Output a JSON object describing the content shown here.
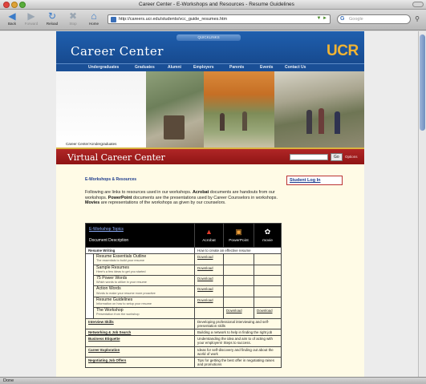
{
  "window": {
    "title": "Career Center - E-Workshops and Resources - Resume Guidelines"
  },
  "toolbar": {
    "back_label": "Back",
    "forward_label": "Forward",
    "reload_label": "Reload",
    "stop_label": "Stop",
    "home_label": "Home",
    "url": "http://careers.ucr.edu/students/vcc_guide_resumes.htm",
    "search_placeholder": "Google"
  },
  "page": {
    "quicklinks": "QUICKLINKS",
    "site_title": "Career Center",
    "logo": "UCR",
    "nav": [
      "Undergraduates",
      "Graduates",
      "Alumni",
      "Employers",
      "Parents",
      "Events",
      "Contact Us"
    ],
    "breadcrumb": "Career Center>Undergraduates",
    "vcc_title": "Virtual Career Center",
    "go_label": "Go",
    "options_label": "Options",
    "section_heading": "E-Workshops & Resources",
    "intro_p1": "Following are links to resources used in our workshops. ",
    "intro_acrobat": "Acrobat",
    "intro_p2": " documents are handouts from our workshops. ",
    "intro_ppt": "PowerPoint",
    "intro_p3": " documents are the presentations used by Career Counselors in workshops. ",
    "intro_movies": "Movies",
    "intro_p4": " are representations of the workshops as given by our counselors.",
    "login_label": "Student Log In",
    "table": {
      "topics_label": "E-Workshop Topics",
      "doc_desc_label": "Document Description",
      "col_acrobat": "Acrobat",
      "col_ppt": "PowerPoint",
      "col_movie": "movie",
      "resume_section": {
        "title": "Resume Writing",
        "desc": "How to create an effective resume"
      },
      "resume_items": [
        {
          "title": "Resume Essentials Outline",
          "desc": "The essentials to build your resume",
          "acrobat": "Download",
          "ppt": "",
          "movie": ""
        },
        {
          "title": "Sample Resumes",
          "desc": "Here's a few ideas to get you started",
          "acrobat": "Download",
          "ppt": "",
          "movie": ""
        },
        {
          "title": "75 Power Words",
          "desc": "Which words to utilize in your resume",
          "acrobat": "Download",
          "ppt": "",
          "movie": ""
        },
        {
          "title": "Action Words",
          "desc": "Words to make your resume more proactive",
          "acrobat": "Download",
          "ppt": "",
          "movie": ""
        },
        {
          "title": "Resume Guidelines",
          "desc": "Information on how to setup your resume",
          "acrobat": "Download",
          "ppt": "",
          "movie": ""
        },
        {
          "title": "The Workshop",
          "desc": "Presentation from the workshop",
          "acrobat": "",
          "ppt": "Download",
          "movie": "Download"
        }
      ],
      "topics": [
        {
          "title": "Interview Skills",
          "desc": "Developing professional interviewing and self-presentation skills"
        },
        {
          "title": "Networking & Job Search",
          "desc": "Building a network to help in finding the right job"
        },
        {
          "title": "Business Etiquette",
          "desc": "Understanding the idea and aim to of acting with your employers! Steps to success."
        },
        {
          "title": "Career Exploration",
          "desc": "Ideas for self-discovery and finding out about the world of work"
        },
        {
          "title": "Negotiating Job Offers",
          "desc": "Tips for getting the best offer in negotiating raises and promotions"
        }
      ]
    }
  },
  "status": {
    "text": "Done"
  }
}
